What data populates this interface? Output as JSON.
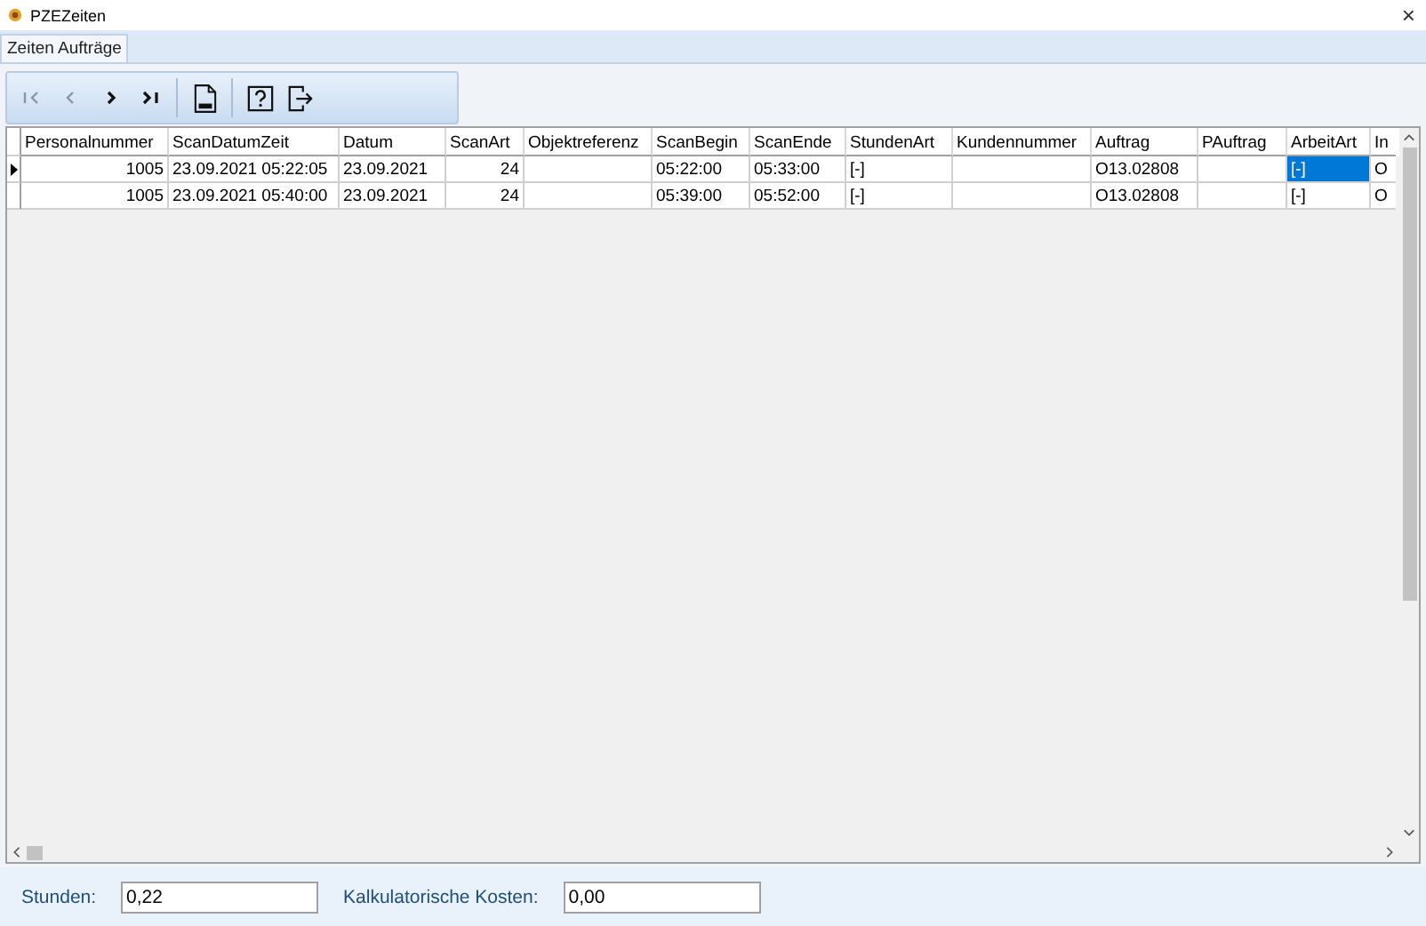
{
  "window": {
    "title": "PZEZeiten",
    "close": "×"
  },
  "tabs": [
    {
      "label": "Zeiten Aufträge",
      "selected": true
    }
  ],
  "toolbar": [
    {
      "kind": "first",
      "disabled": true
    },
    {
      "kind": "prev",
      "disabled": true
    },
    {
      "kind": "next",
      "disabled": false
    },
    {
      "kind": "last",
      "disabled": false
    },
    {
      "kind": "xls",
      "disabled": false
    },
    {
      "kind": "help",
      "disabled": false
    },
    {
      "kind": "exit",
      "disabled": false
    }
  ],
  "table": {
    "columns": [
      {
        "label": "Personalnummer",
        "kind": "number"
      },
      {
        "label": "ScanDatumZeit",
        "kind": "text"
      },
      {
        "label": "Datum",
        "kind": "text"
      },
      {
        "label": "ScanArt",
        "kind": "number"
      },
      {
        "label": "Objektreferenz",
        "kind": "text"
      },
      {
        "label": "ScanBegin",
        "kind": "text"
      },
      {
        "label": "ScanEnde",
        "kind": "text"
      },
      {
        "label": "StundenArt",
        "kind": "text"
      },
      {
        "label": "Kundennummer",
        "kind": "text"
      },
      {
        "label": "Auftrag",
        "kind": "text"
      },
      {
        "label": "PAuftrag",
        "kind": "text"
      },
      {
        "label": "ArbeitArt",
        "kind": "text"
      },
      {
        "label": "In",
        "kind": "text"
      }
    ],
    "rows": [
      {
        "current": true,
        "cells": [
          {
            "text": "1005",
            "selected": false
          },
          {
            "text": "23.09.2021 05:22:05",
            "selected": false
          },
          {
            "text": "23.09.2021",
            "selected": false
          },
          {
            "text": "24",
            "selected": false
          },
          {
            "text": "",
            "selected": false
          },
          {
            "text": "05:22:00",
            "selected": false
          },
          {
            "text": "05:33:00",
            "selected": false
          },
          {
            "text": "[-]",
            "selected": false
          },
          {
            "text": "",
            "selected": false
          },
          {
            "text": "O13.02808",
            "selected": false
          },
          {
            "text": "",
            "selected": false
          },
          {
            "text": "[-]",
            "selected": true
          },
          {
            "text": "O",
            "selected": false
          }
        ]
      },
      {
        "current": false,
        "cells": [
          {
            "text": "1005",
            "selected": false
          },
          {
            "text": "23.09.2021 05:40:00",
            "selected": false
          },
          {
            "text": "23.09.2021",
            "selected": false
          },
          {
            "text": "24",
            "selected": false
          },
          {
            "text": "",
            "selected": false
          },
          {
            "text": "05:39:00",
            "selected": false
          },
          {
            "text": "05:52:00",
            "selected": false
          },
          {
            "text": "[-]",
            "selected": false
          },
          {
            "text": "",
            "selected": false
          },
          {
            "text": "O13.02808",
            "selected": false
          },
          {
            "text": "",
            "selected": false
          },
          {
            "text": "[-]",
            "selected": false
          },
          {
            "text": "O",
            "selected": false
          }
        ]
      }
    ]
  },
  "footer": {
    "fields": [
      {
        "label": "Stunden:",
        "value": "0,22"
      },
      {
        "label": "Kalkulatorische Kosten:",
        "value": "0,00"
      }
    ]
  }
}
